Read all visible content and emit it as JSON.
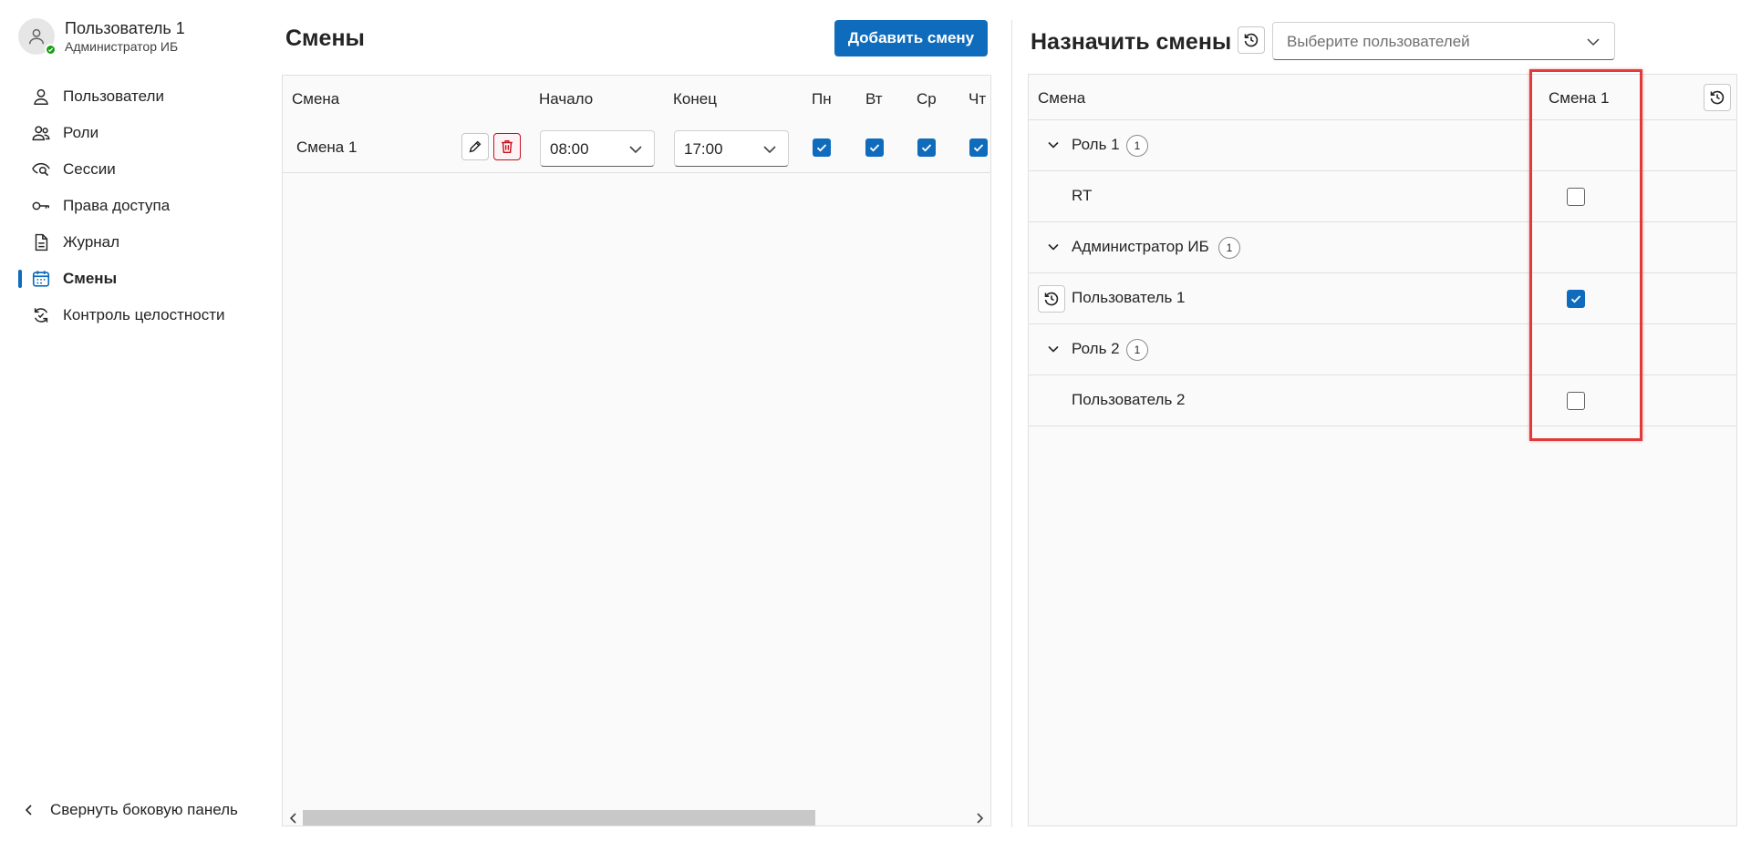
{
  "user": {
    "name": "Пользователь 1",
    "role": "Администратор ИБ"
  },
  "nav": {
    "items": [
      {
        "label": "Пользователи",
        "icon": "person-icon"
      },
      {
        "label": "Роли",
        "icon": "people-icon"
      },
      {
        "label": "Сессии",
        "icon": "eye-search-icon"
      },
      {
        "label": "Права доступа",
        "icon": "key-icon"
      },
      {
        "label": "Журнал",
        "icon": "document-icon"
      },
      {
        "label": "Смены",
        "icon": "calendar-icon",
        "active": true
      },
      {
        "label": "Контроль целостности",
        "icon": "sync-icon"
      }
    ],
    "collapse_label": "Свернуть боковую панель"
  },
  "shifts": {
    "title": "Смены",
    "add_button": "Добавить смену",
    "columns": [
      "Смена",
      "Начало",
      "Конец",
      "Пн",
      "Вт",
      "Ср",
      "Чт"
    ],
    "rows": [
      {
        "name": "Смена 1",
        "start": "08:00",
        "end": "17:00",
        "days": {
          "Пн": true,
          "Вт": true,
          "Ср": true,
          "Чт": true
        }
      }
    ]
  },
  "assign": {
    "title": "Назначить смены",
    "user_select_placeholder": "Выберите пользователей",
    "columns": [
      "Смена",
      "Смена 1"
    ],
    "rows": [
      {
        "type": "group",
        "label": "Роль 1",
        "count": "1"
      },
      {
        "type": "user",
        "label": "RT",
        "checked": false,
        "reset": false
      },
      {
        "type": "group",
        "label": "Администратор ИБ",
        "count": "1"
      },
      {
        "type": "user",
        "label": "Пользователь 1",
        "checked": true,
        "reset": true
      },
      {
        "type": "group",
        "label": "Роль 2",
        "count": "1"
      },
      {
        "type": "user",
        "label": "Пользователь 2",
        "checked": false,
        "reset": false
      }
    ]
  },
  "colors": {
    "accent": "#0f6cbd",
    "danger": "#c50f1f",
    "presence": "#13a10e",
    "highlight": "#e03a3a"
  }
}
